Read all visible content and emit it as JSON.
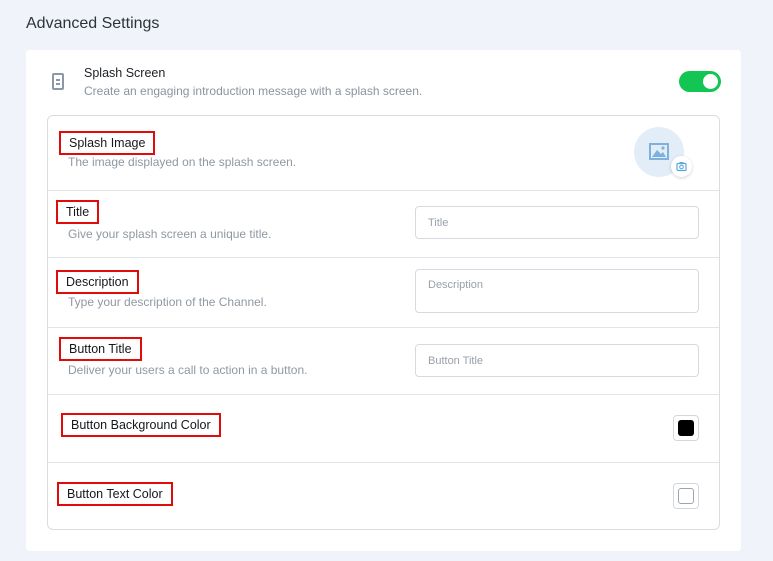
{
  "page": {
    "title": "Advanced Settings"
  },
  "splash": {
    "title": "Splash Screen",
    "subtitle": "Create an engaging introduction message with a splash screen.",
    "enabled": true,
    "toggle_color": "#13c552"
  },
  "fields": {
    "splash_image": {
      "label": "Splash Image",
      "description": "The image displayed on the splash screen."
    },
    "title": {
      "label": "Title",
      "description": "Give your splash screen a unique title.",
      "placeholder": "Title",
      "value": ""
    },
    "description": {
      "label": "Description",
      "description": "Type your description of the Channel.",
      "placeholder": "Description",
      "value": ""
    },
    "button_title": {
      "label": "Button Title",
      "description": "Deliver your users a call to action in a button.",
      "placeholder": "Button Title",
      "value": ""
    },
    "button_bg_color": {
      "label": "Button Background Color",
      "color": "#000000"
    },
    "button_text_color": {
      "label": "Button Text Color",
      "color": "#ffffff"
    }
  }
}
